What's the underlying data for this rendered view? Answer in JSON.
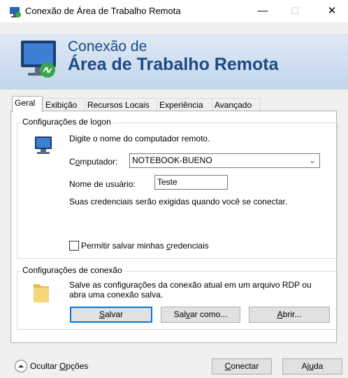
{
  "window": {
    "title": "Conexão de Área de Trabalho Remota",
    "minimize_glyph": "—",
    "maximize_glyph": "☐",
    "close_glyph": "✕"
  },
  "banner": {
    "line1": "Conexão de",
    "line2": "Área de Trabalho Remota"
  },
  "tabs": [
    {
      "label": "Geral",
      "active": true
    },
    {
      "label": "Exibição"
    },
    {
      "label": "Recursos Locais"
    },
    {
      "label": "Experiência"
    },
    {
      "label": "Avançado"
    }
  ],
  "logon": {
    "group_label": "Configurações de logon",
    "instruction": "Digite o nome do computador remoto.",
    "computer_label_pre": "C",
    "computer_label_ul": "o",
    "computer_label_post": "mputador:",
    "computer_value": "NOTEBOOK-BUENO",
    "username_label": "Nome de usuário:",
    "username_value": "Teste",
    "credentials_note": "Suas credenciais serão exigidas quando você se conectar.",
    "save_creds_pre": "Permitir salvar minhas ",
    "save_creds_ul": "c",
    "save_creds_post": "redenciais",
    "save_creds_checked": false
  },
  "connection": {
    "group_label": "Configurações de conexão",
    "description": "Salve as configurações da conexão atual em um arquivo RDP ou abra uma conexão salva.",
    "save_ul": "S",
    "save_post": "alvar",
    "saveas_pre": "Sal",
    "saveas_ul": "v",
    "saveas_post": "ar como...",
    "open_ul": "A",
    "open_post": "brir..."
  },
  "footer": {
    "hide_pre": "Ocultar ",
    "hide_ul": "O",
    "hide_post": "pções",
    "connect_ul": "C",
    "connect_post": "onectar",
    "help_pre": "Aj",
    "help_ul": "u",
    "help_post": "da"
  }
}
